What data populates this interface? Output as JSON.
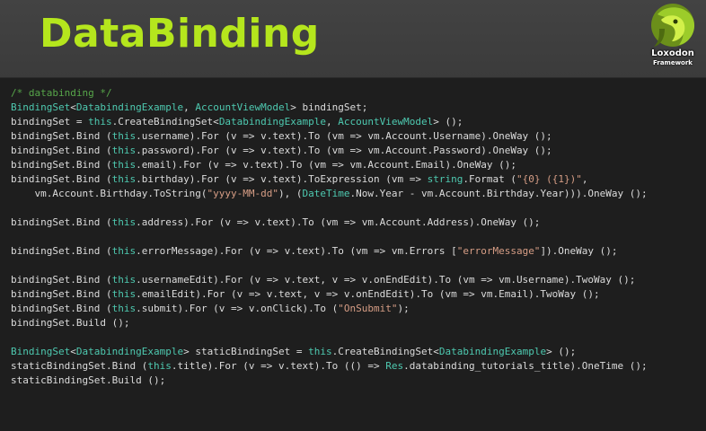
{
  "slide": {
    "title": "DataBinding",
    "logo": {
      "name": "Loxodon",
      "subtitle": "Framework"
    },
    "accent_color": "#b5e61d"
  },
  "code_lines": [
    [
      {
        "t": "/* databinding */",
        "c": "c"
      }
    ],
    [
      {
        "t": "BindingSet",
        "c": "k"
      },
      {
        "t": "<",
        "c": ""
      },
      {
        "t": "DatabindingExample",
        "c": "k"
      },
      {
        "t": ", ",
        "c": ""
      },
      {
        "t": "AccountViewModel",
        "c": "k"
      },
      {
        "t": "> bindingSet;",
        "c": ""
      }
    ],
    [
      {
        "t": "bindingSet = ",
        "c": ""
      },
      {
        "t": "this",
        "c": "k"
      },
      {
        "t": ".CreateBindingSet<",
        "c": ""
      },
      {
        "t": "DatabindingExample",
        "c": "k"
      },
      {
        "t": ", ",
        "c": ""
      },
      {
        "t": "AccountViewModel",
        "c": "k"
      },
      {
        "t": "> ();",
        "c": ""
      }
    ],
    [
      {
        "t": "bindingSet.Bind (",
        "c": ""
      },
      {
        "t": "this",
        "c": "k"
      },
      {
        "t": ".username).For (v => v.text).To (vm => vm.Account.Username).OneWay ();",
        "c": ""
      }
    ],
    [
      {
        "t": "bindingSet.Bind (",
        "c": ""
      },
      {
        "t": "this",
        "c": "k"
      },
      {
        "t": ".password).For (v => v.text).To (vm => vm.Account.Password).OneWay ();",
        "c": ""
      }
    ],
    [
      {
        "t": "bindingSet.Bind (",
        "c": ""
      },
      {
        "t": "this",
        "c": "k"
      },
      {
        "t": ".email).For (v => v.text).To (vm => vm.Account.Email).OneWay ();",
        "c": ""
      }
    ],
    [
      {
        "t": "bindingSet.Bind (",
        "c": ""
      },
      {
        "t": "this",
        "c": "k"
      },
      {
        "t": ".birthday).For (v => v.text).ToExpression (vm => ",
        "c": ""
      },
      {
        "t": "string",
        "c": "k"
      },
      {
        "t": ".Format (",
        "c": ""
      },
      {
        "t": "\"{0} ({1})\"",
        "c": "s"
      },
      {
        "t": ",",
        "c": ""
      }
    ],
    [
      {
        "t": "    vm.Account.Birthday.ToString(",
        "c": ""
      },
      {
        "t": "\"yyyy-MM-dd\"",
        "c": "s"
      },
      {
        "t": "), (",
        "c": ""
      },
      {
        "t": "DateTime",
        "c": "k"
      },
      {
        "t": ".Now.Year - vm.Account.Birthday.Year))).OneWay ();",
        "c": ""
      }
    ],
    [],
    [
      {
        "t": "bindingSet.Bind (",
        "c": ""
      },
      {
        "t": "this",
        "c": "k"
      },
      {
        "t": ".address).For (v => v.text).To (vm => vm.Account.Address).OneWay ();",
        "c": ""
      }
    ],
    [],
    [
      {
        "t": "bindingSet.Bind (",
        "c": ""
      },
      {
        "t": "this",
        "c": "k"
      },
      {
        "t": ".errorMessage).For (v => v.text).To (vm => vm.Errors [",
        "c": ""
      },
      {
        "t": "\"errorMessage\"",
        "c": "s"
      },
      {
        "t": "]).OneWay ();",
        "c": ""
      }
    ],
    [],
    [
      {
        "t": "bindingSet.Bind (",
        "c": ""
      },
      {
        "t": "this",
        "c": "k"
      },
      {
        "t": ".usernameEdit).For (v => v.text, v => v.onEndEdit).To (vm => vm.Username).TwoWay ();",
        "c": ""
      }
    ],
    [
      {
        "t": "bindingSet.Bind (",
        "c": ""
      },
      {
        "t": "this",
        "c": "k"
      },
      {
        "t": ".emailEdit).For (v => v.text, v => v.onEndEdit).To (vm => vm.Email).TwoWay ();",
        "c": ""
      }
    ],
    [
      {
        "t": "bindingSet.Bind (",
        "c": ""
      },
      {
        "t": "this",
        "c": "k"
      },
      {
        "t": ".submit).For (v => v.onClick).To (",
        "c": ""
      },
      {
        "t": "\"OnSubmit\"",
        "c": "s"
      },
      {
        "t": ");",
        "c": ""
      }
    ],
    [
      {
        "t": "bindingSet.Build ();",
        "c": ""
      }
    ],
    [],
    [
      {
        "t": "BindingSet",
        "c": "k"
      },
      {
        "t": "<",
        "c": ""
      },
      {
        "t": "DatabindingExample",
        "c": "k"
      },
      {
        "t": "> staticBindingSet = ",
        "c": ""
      },
      {
        "t": "this",
        "c": "k"
      },
      {
        "t": ".CreateBindingSet<",
        "c": ""
      },
      {
        "t": "DatabindingExample",
        "c": "k"
      },
      {
        "t": "> ();",
        "c": ""
      }
    ],
    [
      {
        "t": "staticBindingSet.Bind (",
        "c": ""
      },
      {
        "t": "this",
        "c": "k"
      },
      {
        "t": ".title).For (v => v.text).To (() => ",
        "c": ""
      },
      {
        "t": "Res",
        "c": "k"
      },
      {
        "t": ".databinding_tutorials_title).OneTime ();",
        "c": ""
      }
    ],
    [
      {
        "t": "staticBindingSet.Build ();",
        "c": ""
      }
    ]
  ]
}
